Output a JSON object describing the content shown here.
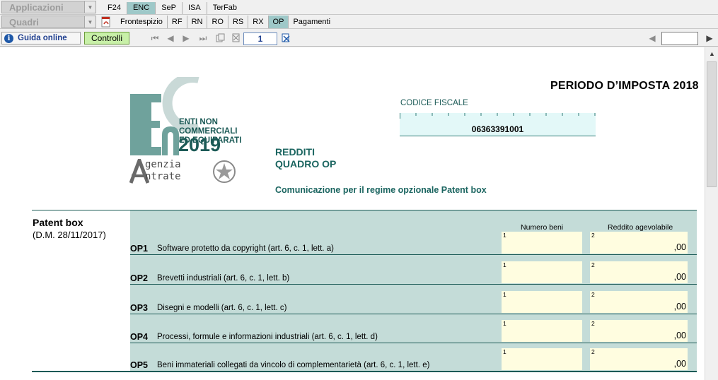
{
  "app": {
    "applicazioni_label": "Applicazioni",
    "quadri_label": "Quadri",
    "tabs": [
      {
        "label": "F24",
        "active": false
      },
      {
        "label": "ENC",
        "active": true
      },
      {
        "label": "SeP",
        "active": false
      },
      {
        "label": "ISA",
        "active": false
      },
      {
        "label": "TerFab",
        "active": false
      }
    ],
    "quadri_tabs": [
      {
        "label": "Frontespizio",
        "active": false
      },
      {
        "label": "RF",
        "active": false
      },
      {
        "label": "RN",
        "active": false
      },
      {
        "label": "RO",
        "active": false
      },
      {
        "label": "RS",
        "active": false
      },
      {
        "label": "RX",
        "active": false
      },
      {
        "label": "OP",
        "active": true
      },
      {
        "label": "Pagamenti",
        "active": false
      }
    ],
    "guida_label": "Guida online",
    "controlli_label": "Controlli",
    "page_number": "1",
    "accent_color": "#9ec8c8"
  },
  "doc": {
    "logo": {
      "line1": "ENTI NON COMMERCIALI",
      "line2": "ED EQUIPARATI",
      "year": "2019",
      "agenzia": "genzia",
      "entrate": "ntrate"
    },
    "periodo": "PERIODO D’IMPOSTA 2018",
    "codice_fiscale_label": "CODICE FISCALE",
    "codice_fiscale_value": "06363391001",
    "redditi": "REDDITI",
    "quadro": "QUADRO OP",
    "comunicazione": "Comunicazione per il regime opzionale Patent box",
    "section_title": "Patent box",
    "section_subtitle": "(D.M. 28/11/2017)",
    "col_numero": "Numero beni",
    "col_reddito": "Reddito agevolabile",
    "rows": [
      {
        "code": "OP1",
        "desc": "Software protetto da copyright (art. 6, c. 1, lett. a)",
        "n1": "1",
        "n2": "2",
        "value": ",00"
      },
      {
        "code": "OP2",
        "desc": "Brevetti industriali (art. 6, c. 1, lett. b)",
        "n1": "1",
        "n2": "2",
        "value": ",00"
      },
      {
        "code": "OP3",
        "desc": "Disegni e modelli (art. 6, c. 1, lett. c)",
        "n1": "1",
        "n2": "2",
        "value": ",00"
      },
      {
        "code": "OP4",
        "desc": "Processi, formule e informazioni industriali (art. 6, c. 1, lett. d)",
        "n1": "1",
        "n2": "2",
        "value": ",00"
      },
      {
        "code": "OP5",
        "desc": "Beni immateriali collegati da vincolo di complementarietà (art. 6, c. 1, lett. e)",
        "n1": "1",
        "n2": "2",
        "value": ",00"
      }
    ]
  }
}
